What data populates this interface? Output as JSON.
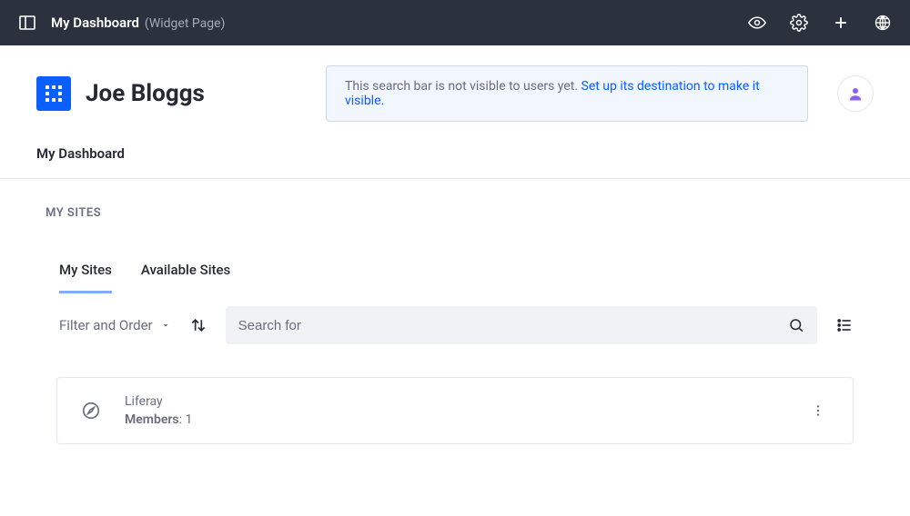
{
  "topbar": {
    "title": "My Dashboard",
    "subtitle": "(Widget Page)"
  },
  "header": {
    "page_title": "Joe Bloggs",
    "info_text_prefix": "This search bar is not visible to users yet. ",
    "info_link": "Set up its destination to make it visible."
  },
  "subnav": {
    "label": "My Dashboard"
  },
  "section": {
    "label": "MY SITES"
  },
  "tabs": {
    "my_sites": "My Sites",
    "available_sites": "Available Sites"
  },
  "toolbar": {
    "filter_label": "Filter and Order",
    "search_placeholder": "Search for"
  },
  "site": {
    "name": "Liferay",
    "members_label": "Members",
    "members_count": ": 1"
  }
}
